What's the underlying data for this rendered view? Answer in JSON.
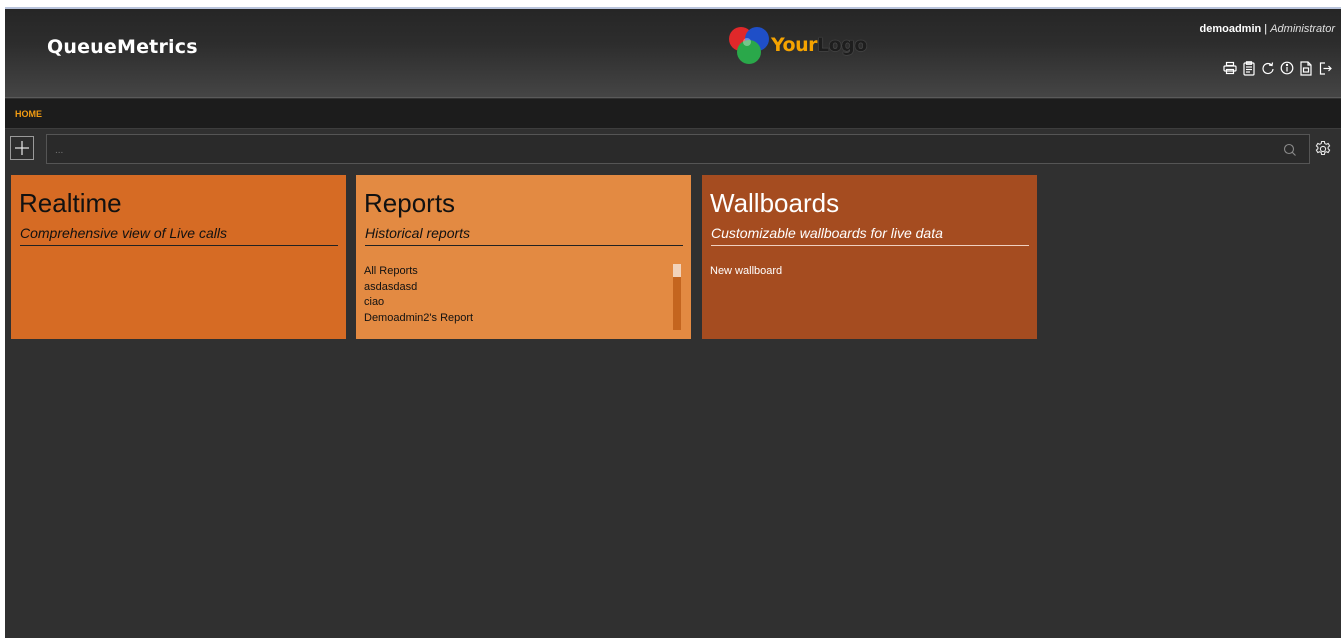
{
  "header": {
    "app_title": "QueueMetrics",
    "logo": {
      "part1": "Your",
      "part2": "Logo",
      "color1": "#f5a300",
      "color2": "#2a2a2a"
    },
    "user": {
      "name": "demoadmin",
      "separator": " | ",
      "role": "Administrator"
    },
    "toolbar_icons": [
      "print-icon",
      "clipboard-icon",
      "refresh-icon",
      "info-icon",
      "document-icon",
      "logout-icon"
    ]
  },
  "nav": {
    "home_label": "HOME",
    "accent_color": "#f39c12"
  },
  "search": {
    "placeholder": "...",
    "value": ""
  },
  "cards": {
    "realtime": {
      "title": "Realtime",
      "subtitle": "Comprehensive view of Live calls",
      "color": "#d66b24"
    },
    "reports": {
      "title": "Reports",
      "subtitle": "Historical reports",
      "color": "#e38a42",
      "items": [
        "All Reports",
        "asdasdasd",
        "ciao",
        "Demoadmin2's Report"
      ]
    },
    "wallboards": {
      "title": "Wallboards",
      "subtitle": "Customizable wallboards for live data",
      "color": "#a54c20",
      "items": [
        "New wallboard"
      ]
    }
  },
  "colors": {
    "background": "#303030",
    "header_dark": "#262626"
  }
}
